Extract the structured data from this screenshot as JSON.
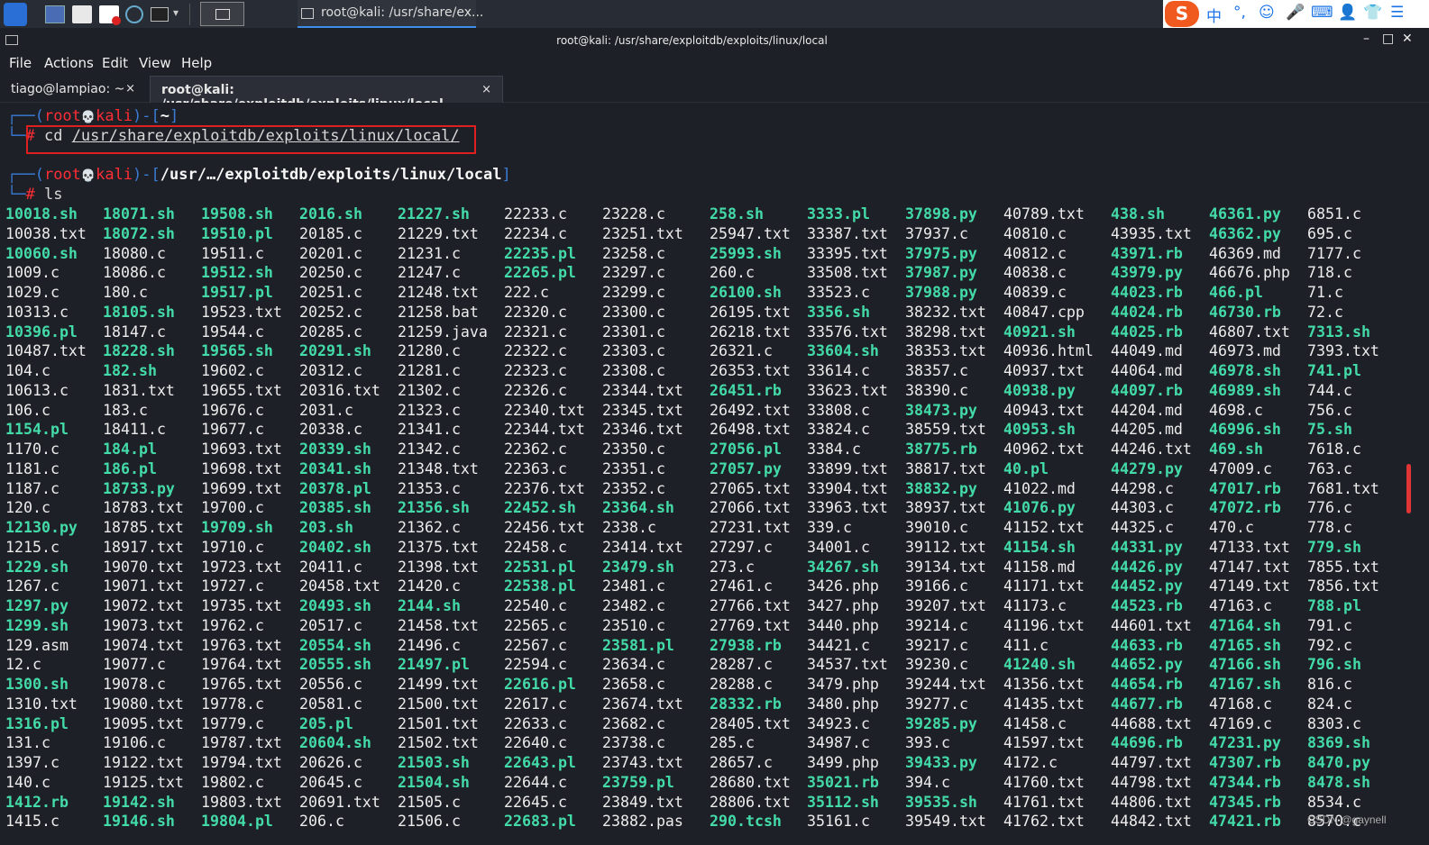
{
  "panel": {
    "task_label": "root@kali: /usr/share/ex...",
    "ime": "S",
    "tray": [
      "中",
      "°,",
      "☺",
      "🎤",
      "⌨",
      "👤",
      "👕",
      "☰"
    ]
  },
  "window": {
    "title": "root@kali: /usr/share/exploitdb/exploits/linux/local",
    "min": "–",
    "max": "□",
    "close": "✕"
  },
  "menu": [
    "File",
    "Actions",
    "Edit",
    "View",
    "Help"
  ],
  "tabs": [
    {
      "label": "tiago@lampiao: ~",
      "close": "×"
    },
    {
      "label": "root@kali: /usr/share/exploitdb/exploits/linux/local",
      "close": "×"
    }
  ],
  "term": {
    "p1": {
      "corner": "┌──(",
      "user": "root",
      "skull": "💀",
      "host": "kali",
      "mid": ")-[",
      "path": "~",
      "end": "]",
      "hash_pre": "└─",
      "hash": "#",
      "cmd_pre": " cd ",
      "cmd_arg": "/usr/share/exploitdb/exploits/linux/local/"
    },
    "p2": {
      "corner": "┌──(",
      "user": "root",
      "skull": "💀",
      "host": "kali",
      "mid": ")-[",
      "path": "/usr/…/exploitdb/exploits/linux/local",
      "end": "]",
      "hash_pre": "└─",
      "hash": "#",
      "cmd": " ls"
    },
    "ls_columns": [
      [
        "*10018.sh",
        "10038.txt",
        "*10060.sh",
        "1009.c",
        "1029.c",
        "10313.c",
        "*10396.pl",
        "10487.txt",
        "104.c",
        "10613.c",
        "106.c",
        "*1154.pl",
        "1170.c",
        "1181.c",
        "1187.c",
        "120.c",
        "*12130.py",
        "1215.c",
        "*1229.sh",
        "1267.c",
        "*1297.py",
        "*1299.sh",
        "129.asm",
        "12.c",
        "*1300.sh",
        "1310.txt",
        "*1316.pl",
        "131.c",
        "1397.c",
        "140.c",
        "*1412.rb",
        "1415.c"
      ],
      [
        "*18071.sh",
        "*18072.sh",
        "18080.c",
        "18086.c",
        "180.c",
        "*18105.sh",
        "18147.c",
        "*18228.sh",
        "*182.sh",
        "1831.txt",
        "183.c",
        "18411.c",
        "*184.pl",
        "*186.pl",
        "*18733.py",
        "18783.txt",
        "18785.txt",
        "18917.txt",
        "19070.txt",
        "19071.txt",
        "19072.txt",
        "19073.txt",
        "19074.txt",
        "19077.c",
        "19078.c",
        "19080.txt",
        "19095.txt",
        "19106.c",
        "19122.txt",
        "19125.txt",
        "*19142.sh",
        "*19146.sh"
      ],
      [
        "*19508.sh",
        "*19510.pl",
        "19511.c",
        "*19512.sh",
        "*19517.pl",
        "19523.txt",
        "19544.c",
        "*19565.sh",
        "19602.c",
        "19655.txt",
        "19676.c",
        "19677.c",
        "19693.txt",
        "19698.txt",
        "19699.txt",
        "19700.c",
        "*19709.sh",
        "19710.c",
        "19723.txt",
        "19727.c",
        "19735.txt",
        "19762.c",
        "19763.txt",
        "19764.txt",
        "19765.txt",
        "19778.c",
        "19779.c",
        "19787.txt",
        "19794.txt",
        "19802.c",
        "19803.txt",
        "*19804.pl"
      ],
      [
        "*2016.sh",
        "20185.c",
        "20201.c",
        "20250.c",
        "20251.c",
        "20252.c",
        "20285.c",
        "*20291.sh",
        "20312.c",
        "20316.txt",
        "2031.c",
        "20338.c",
        "*20339.sh",
        "*20341.sh",
        "*20378.pl",
        "*20385.sh",
        "*203.sh",
        "*20402.sh",
        "20411.c",
        "20458.txt",
        "*20493.sh",
        "20517.c",
        "*20554.sh",
        "*20555.sh",
        "20556.c",
        "20581.c",
        "*205.pl",
        "*20604.sh",
        "20626.c",
        "20645.c",
        "20691.txt",
        "206.c"
      ],
      [
        "*21227.sh",
        "21229.txt",
        "21231.c",
        "21247.c",
        "21248.txt",
        "21258.bat",
        "21259.java",
        "21280.c",
        "21281.c",
        "21302.c",
        "21323.c",
        "21341.c",
        "21342.c",
        "21348.txt",
        "21353.c",
        "*21356.sh",
        "21362.c",
        "21375.txt",
        "21398.txt",
        "21420.c",
        "*2144.sh",
        "21458.txt",
        "21496.c",
        "*21497.pl",
        "21499.txt",
        "21500.txt",
        "21501.txt",
        "21502.txt",
        "*21503.sh",
        "*21504.sh",
        "21505.c",
        "21506.c"
      ],
      [
        "22233.c",
        "22234.c",
        "*22235.pl",
        "*22265.pl",
        "222.c",
        "22320.c",
        "22321.c",
        "22322.c",
        "22323.c",
        "22326.c",
        "22340.txt",
        "22344.txt",
        "22362.c",
        "22363.c",
        "22376.txt",
        "*22452.sh",
        "22456.txt",
        "22458.c",
        "*22531.pl",
        "*22538.pl",
        "22540.c",
        "22565.c",
        "22567.c",
        "22594.c",
        "*22616.pl",
        "22617.c",
        "22633.c",
        "22640.c",
        "*22643.pl",
        "22644.c",
        "22645.c",
        "*22683.pl"
      ],
      [
        "23228.c",
        "23251.txt",
        "23258.c",
        "23297.c",
        "23299.c",
        "23300.c",
        "23301.c",
        "23303.c",
        "23308.c",
        "23344.txt",
        "23345.txt",
        "23346.txt",
        "23350.c",
        "23351.c",
        "23352.c",
        "*23364.sh",
        "2338.c",
        "23414.txt",
        "*23479.sh",
        "23481.c",
        "23482.c",
        "23510.c",
        "*23581.pl",
        "23634.c",
        "23658.c",
        "23674.txt",
        "23682.c",
        "23738.c",
        "23743.txt",
        "*23759.pl",
        "23849.txt",
        "23882.pas"
      ],
      [
        "*258.sh",
        "25947.txt",
        "*25993.sh",
        "260.c",
        "*26100.sh",
        "26195.txt",
        "26218.txt",
        "26321.c",
        "26353.txt",
        "*26451.rb",
        "26492.txt",
        "26498.txt",
        "*27056.pl",
        "*27057.py",
        "27065.txt",
        "27066.txt",
        "27231.txt",
        "27297.c",
        "273.c",
        "27461.c",
        "27766.txt",
        "27769.txt",
        "*27938.rb",
        "28287.c",
        "28288.c",
        "*28332.rb",
        "28405.txt",
        "285.c",
        "28657.c",
        "28680.txt",
        "28806.txt",
        "*290.tcsh"
      ],
      [
        "*3333.pl",
        "33387.txt",
        "33395.txt",
        "33508.txt",
        "33523.c",
        "*3356.sh",
        "33576.txt",
        "*33604.sh",
        "33614.c",
        "33623.txt",
        "33808.c",
        "33824.c",
        "3384.c",
        "33899.txt",
        "33904.txt",
        "33963.txt",
        "339.c",
        "34001.c",
        "*34267.sh",
        "3426.php",
        "3427.php",
        "3440.php",
        "34421.c",
        "34537.txt",
        "3479.php",
        "3480.php",
        "34923.c",
        "34987.c",
        "3499.php",
        "*35021.rb",
        "*35112.sh",
        "35161.c"
      ],
      [
        "*37898.py",
        "37937.c",
        "*37975.py",
        "*37987.py",
        "*37988.py",
        "38232.txt",
        "38298.txt",
        "38353.txt",
        "38357.c",
        "38390.c",
        "*38473.py",
        "38559.txt",
        "*38775.rb",
        "38817.txt",
        "*38832.py",
        "38937.txt",
        "39010.c",
        "39112.txt",
        "39134.txt",
        "39166.c",
        "39207.txt",
        "39214.c",
        "39217.c",
        "39230.c",
        "39244.txt",
        "39277.c",
        "*39285.py",
        "393.c",
        "*39433.py",
        "394.c",
        "*39535.sh",
        "39549.txt"
      ],
      [
        "40789.txt",
        "40810.c",
        "40812.c",
        "40838.c",
        "40839.c",
        "40847.cpp",
        "*40921.sh",
        "40936.html",
        "40937.txt",
        "*40938.py",
        "40943.txt",
        "*40953.sh",
        "40962.txt",
        "*40.pl",
        "41022.md",
        "*41076.py",
        "41152.txt",
        "*41154.sh",
        "41158.md",
        "41171.txt",
        "41173.c",
        "41196.txt",
        "411.c",
        "*41240.sh",
        "41356.txt",
        "41435.txt",
        "41458.c",
        "41597.txt",
        "4172.c",
        "41760.txt",
        "41761.txt",
        "41762.txt"
      ],
      [
        "*438.sh",
        "43935.txt",
        "*43971.rb",
        "*43979.py",
        "*44023.rb",
        "*44024.rb",
        "*44025.rb",
        "44049.md",
        "44064.md",
        "*44097.rb",
        "44204.md",
        "44205.md",
        "44246.txt",
        "*44279.py",
        "44298.c",
        "44303.c",
        "44325.c",
        "*44331.py",
        "*44426.py",
        "*44452.py",
        "*44523.rb",
        "44601.txt",
        "*44633.rb",
        "*44652.py",
        "*44654.rb",
        "*44677.rb",
        "44688.txt",
        "*44696.rb",
        "44797.txt",
        "44798.txt",
        "44806.txt",
        "44842.txt"
      ],
      [
        "*46361.py",
        "*46362.py",
        "46369.md",
        "46676.php",
        "*466.pl",
        "*46730.rb",
        "46807.txt",
        "46973.md",
        "*46978.sh",
        "*46989.sh",
        "4698.c",
        "*46996.sh",
        "*469.sh",
        "47009.c",
        "*47017.rb",
        "*47072.rb",
        "470.c",
        "47133.txt",
        "47147.txt",
        "47149.txt",
        "47163.c",
        "*47164.sh",
        "*47165.sh",
        "*47166.sh",
        "*47167.sh",
        "47168.c",
        "47169.c",
        "*47231.py",
        "*47307.rb",
        "*47344.rb",
        "*47345.rb",
        "*47421.rb"
      ],
      [
        "6851.c",
        "695.c",
        "7177.c",
        "718.c",
        "71.c",
        "72.c",
        "*7313.sh",
        "7393.txt",
        "*741.pl",
        "744.c",
        "756.c",
        "*75.sh",
        "7618.c",
        "763.c",
        "7681.txt",
        "776.c",
        "778.c",
        "*779.sh",
        "7855.txt",
        "7856.txt",
        "*788.pl",
        "791.c",
        "792.c",
        "*796.sh",
        "816.c",
        "824.c",
        "8303.c",
        "*8369.sh",
        "*8470.py",
        "*8478.sh",
        "8534.c",
        "8570.c"
      ]
    ]
  },
  "watermark": "CSDN @gaynell",
  "colors": {
    "bg": "#1e2027",
    "exec": "#43dba8",
    "file": "#ececec",
    "prompt_deco": "#3a7bd5",
    "prompt_user": "#ff2d35",
    "highlight_box": "#e02020"
  }
}
